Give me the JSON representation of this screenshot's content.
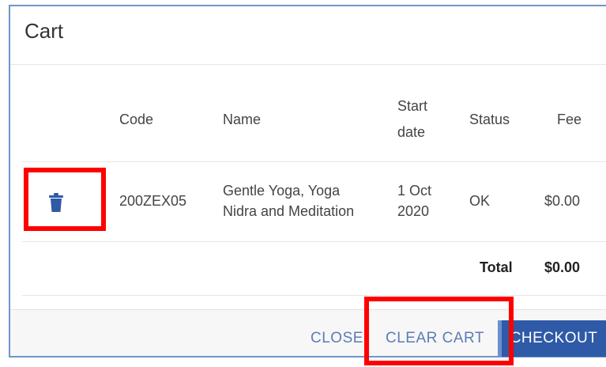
{
  "dialog": {
    "title": "Cart"
  },
  "table": {
    "headers": {
      "code": "Code",
      "name": "Name",
      "start_date_1": "Start",
      "start_date_2": "date",
      "status": "Status",
      "fee": "Fee"
    },
    "rows": [
      {
        "code": "200ZEX05",
        "name_1": "Gentle Yoga, Yoga",
        "name_2": "Nidra and Meditation",
        "start_1": "1 Oct",
        "start_2": "2020",
        "status": "OK",
        "fee": "$0.00"
      }
    ],
    "total_label": "Total",
    "total_value": "$0.00"
  },
  "actions": {
    "close": "CLOSE",
    "clear_cart": "CLEAR CART",
    "checkout": "CHECKOUT"
  },
  "colors": {
    "accent": "#2f5aa7",
    "link": "#5b7db5",
    "highlight": "#ff0000",
    "border": "#6f96c9"
  },
  "icons": {
    "delete": "trash-icon"
  }
}
